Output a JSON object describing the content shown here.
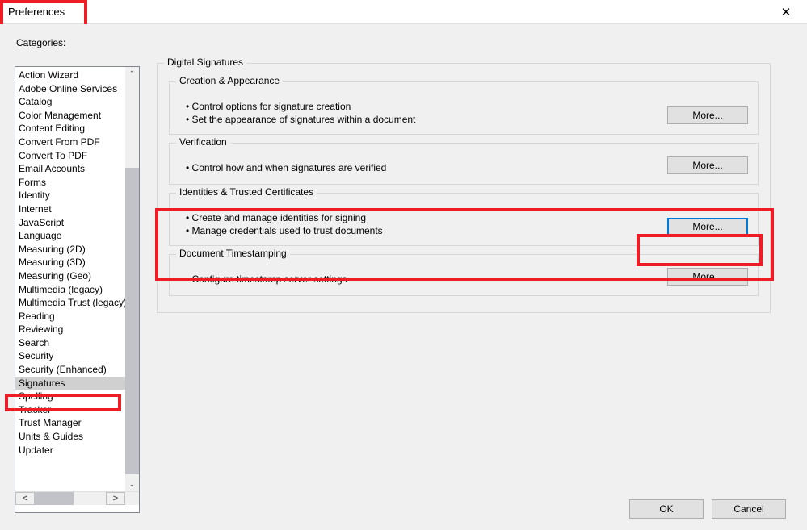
{
  "window": {
    "title": "Preferences",
    "close_glyph": "✕"
  },
  "sidebar": {
    "label": "Categories:",
    "items": [
      "Action Wizard",
      "Adobe Online Services",
      "Catalog",
      "Color Management",
      "Content Editing",
      "Convert From PDF",
      "Convert To PDF",
      "Email Accounts",
      "Forms",
      "Identity",
      "Internet",
      "JavaScript",
      "Language",
      "Measuring (2D)",
      "Measuring (3D)",
      "Measuring (Geo)",
      "Multimedia (legacy)",
      "Multimedia Trust (legacy)",
      "Reading",
      "Reviewing",
      "Search",
      "Security",
      "Security (Enhanced)",
      "Signatures",
      "Spelling",
      "Tracker",
      "Trust Manager",
      "Units & Guides",
      "Updater"
    ],
    "selected_index": 23
  },
  "panel": {
    "heading": "Digital Signatures",
    "groups": [
      {
        "title": "Creation & Appearance",
        "bullets": [
          "Control options for signature creation",
          "Set the appearance of signatures within a document"
        ],
        "button": "More..."
      },
      {
        "title": "Verification",
        "bullets": [
          "Control how and when signatures are verified"
        ],
        "button": "More..."
      },
      {
        "title": "Identities & Trusted Certificates",
        "bullets": [
          "Create and manage identities for signing",
          "Manage credentials used to trust documents"
        ],
        "button": "More..."
      },
      {
        "title": "Document Timestamping",
        "bullets": [
          "Configure timestamp server settings"
        ],
        "button": "More..."
      }
    ]
  },
  "footer": {
    "ok": "OK",
    "cancel": "Cancel"
  }
}
